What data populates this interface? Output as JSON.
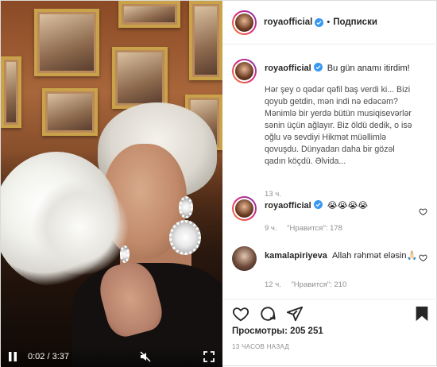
{
  "post": {
    "username": "royaofficial",
    "follow_label": "Подписки",
    "header_separator": "•"
  },
  "video": {
    "time": "0:02 / 3:37",
    "icons": {
      "play": "pause-icon",
      "mute": "muted-speaker-icon",
      "fullscreen": "fullscreen-icon"
    }
  },
  "caption": {
    "username": "royaofficial",
    "title": "Bu gün anamı itirdim!",
    "body": "Hər şey o qədər qəfil baş verdi ki... Bizi qoyub getdin, mən indi nə edəcəm? Mənimlə bir yerdə bütün musiqisevərlər sənin üçün ağlayır. Biz öldü dedik, o isə oğlu və sevdiyi Hikmət müəllimlə qovuşdu. Dünyadan daha bir gözəl qadın köçdü. Əlvida...",
    "time": "13 ч."
  },
  "comments": [
    {
      "username": "royaofficial",
      "text": "😭😭😭😭",
      "time": "9 ч.",
      "likes": "\"Нравится\": 178"
    },
    {
      "username": "kamalapiriyeva",
      "text": "Allah rəhmət eləsin🙏🏻",
      "time": "12 ч.",
      "likes": "\"Нравится\": 210"
    }
  ],
  "stats": {
    "views_label": "Просмотры:",
    "views_value": "205 251",
    "posted_ago": "13 ЧАСОВ НАЗАД"
  },
  "colors": {
    "verified": "#3897f0",
    "text": "#262626",
    "muted": "#8e8e8e",
    "divider": "#efefef"
  }
}
